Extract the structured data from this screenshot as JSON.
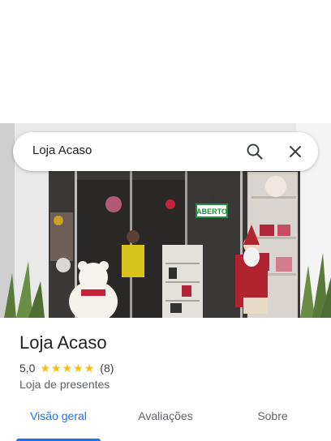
{
  "search": {
    "query": "Loja Acaso",
    "search_icon": "search-icon",
    "close_icon": "close-icon"
  },
  "photo": {
    "sign_text": "ABERTO"
  },
  "place": {
    "title": "Loja Acaso",
    "rating": "5,0",
    "stars": 5,
    "review_count": "(8)",
    "category": "Loja de presentes"
  },
  "tabs": [
    {
      "label": "Visão geral",
      "active": true
    },
    {
      "label": "Avaliações",
      "active": false
    },
    {
      "label": "Sobre",
      "active": false
    }
  ],
  "colors": {
    "accent": "#1a73e8",
    "star": "#fbbc04",
    "sign_green": "#1e8e3e"
  }
}
